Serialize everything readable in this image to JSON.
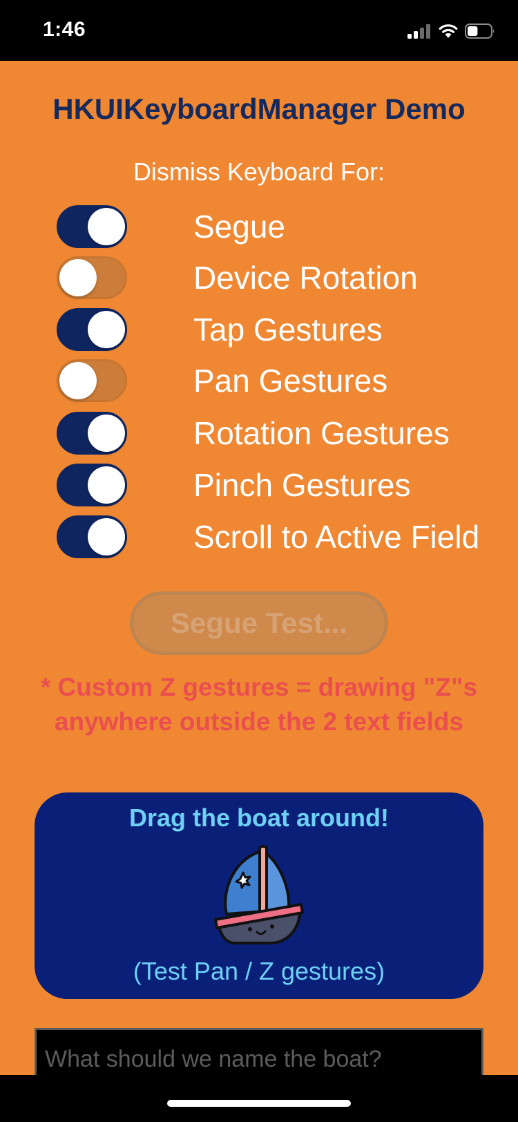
{
  "status_bar": {
    "time": "1:46",
    "signal_icon": "cellular-signal-icon",
    "wifi_icon": "wifi-icon",
    "battery_icon": "battery-icon",
    "battery_level": 0.45
  },
  "app": {
    "title": "HKUIKeyboardManager Demo",
    "section_heading": "Dismiss Keyboard For:"
  },
  "toggles": [
    {
      "label": "Segue",
      "on": true
    },
    {
      "label": "Device Rotation",
      "on": false
    },
    {
      "label": "Tap Gestures",
      "on": true
    },
    {
      "label": "Pan Gestures",
      "on": false
    },
    {
      "label": "Rotation Gestures",
      "on": true
    },
    {
      "label": "Pinch Gestures",
      "on": true
    },
    {
      "label": "Scroll to Active Field",
      "on": true
    }
  ],
  "segue_button": {
    "label": "Segue Test...",
    "enabled": false
  },
  "note": {
    "line1": "* Custom Z gestures = drawing \"Z\"s",
    "line2": "anywhere outside the 2 text fields"
  },
  "boat_card": {
    "title": "Drag the boat around!",
    "caption": "(Test Pan / Z gestures)",
    "icon": "sailboat-icon"
  },
  "name_input": {
    "value": "",
    "placeholder": "What should we name the boat?"
  },
  "colors": {
    "background": "#ef8733",
    "title": "#14295e",
    "toggle_on": "#0f2560",
    "toggle_off": "#cc7d3a",
    "note": "#e94f4f",
    "card": "#0a1f78",
    "card_text": "#6fd0f6"
  }
}
